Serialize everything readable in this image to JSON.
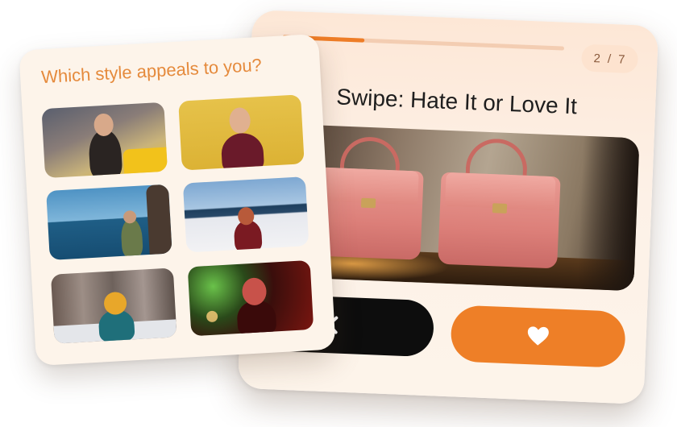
{
  "swipe_card": {
    "title": "Swipe: Hate It or Love It",
    "progress_fraction": 0.29,
    "step_current": "2",
    "step_separator": "/",
    "step_total": "7",
    "photo_subject": "pink handbags",
    "hate_icon": "close-icon",
    "love_icon": "heart-icon"
  },
  "style_card": {
    "title": "Which style appeals to you?",
    "options": [
      {
        "subject": "woman in city street"
      },
      {
        "subject": "woman on yellow background"
      },
      {
        "subject": "woman by the sea"
      },
      {
        "subject": "woman on snowy beach"
      },
      {
        "subject": "woman in yellow beanie in snowy forest"
      },
      {
        "subject": "woman with red neon lights"
      }
    ]
  },
  "colors": {
    "accent": "#ee7f27",
    "title_orange": "#e58a3c",
    "hate_button": "#0d0d0d",
    "card_background": "#fdf4ea"
  }
}
